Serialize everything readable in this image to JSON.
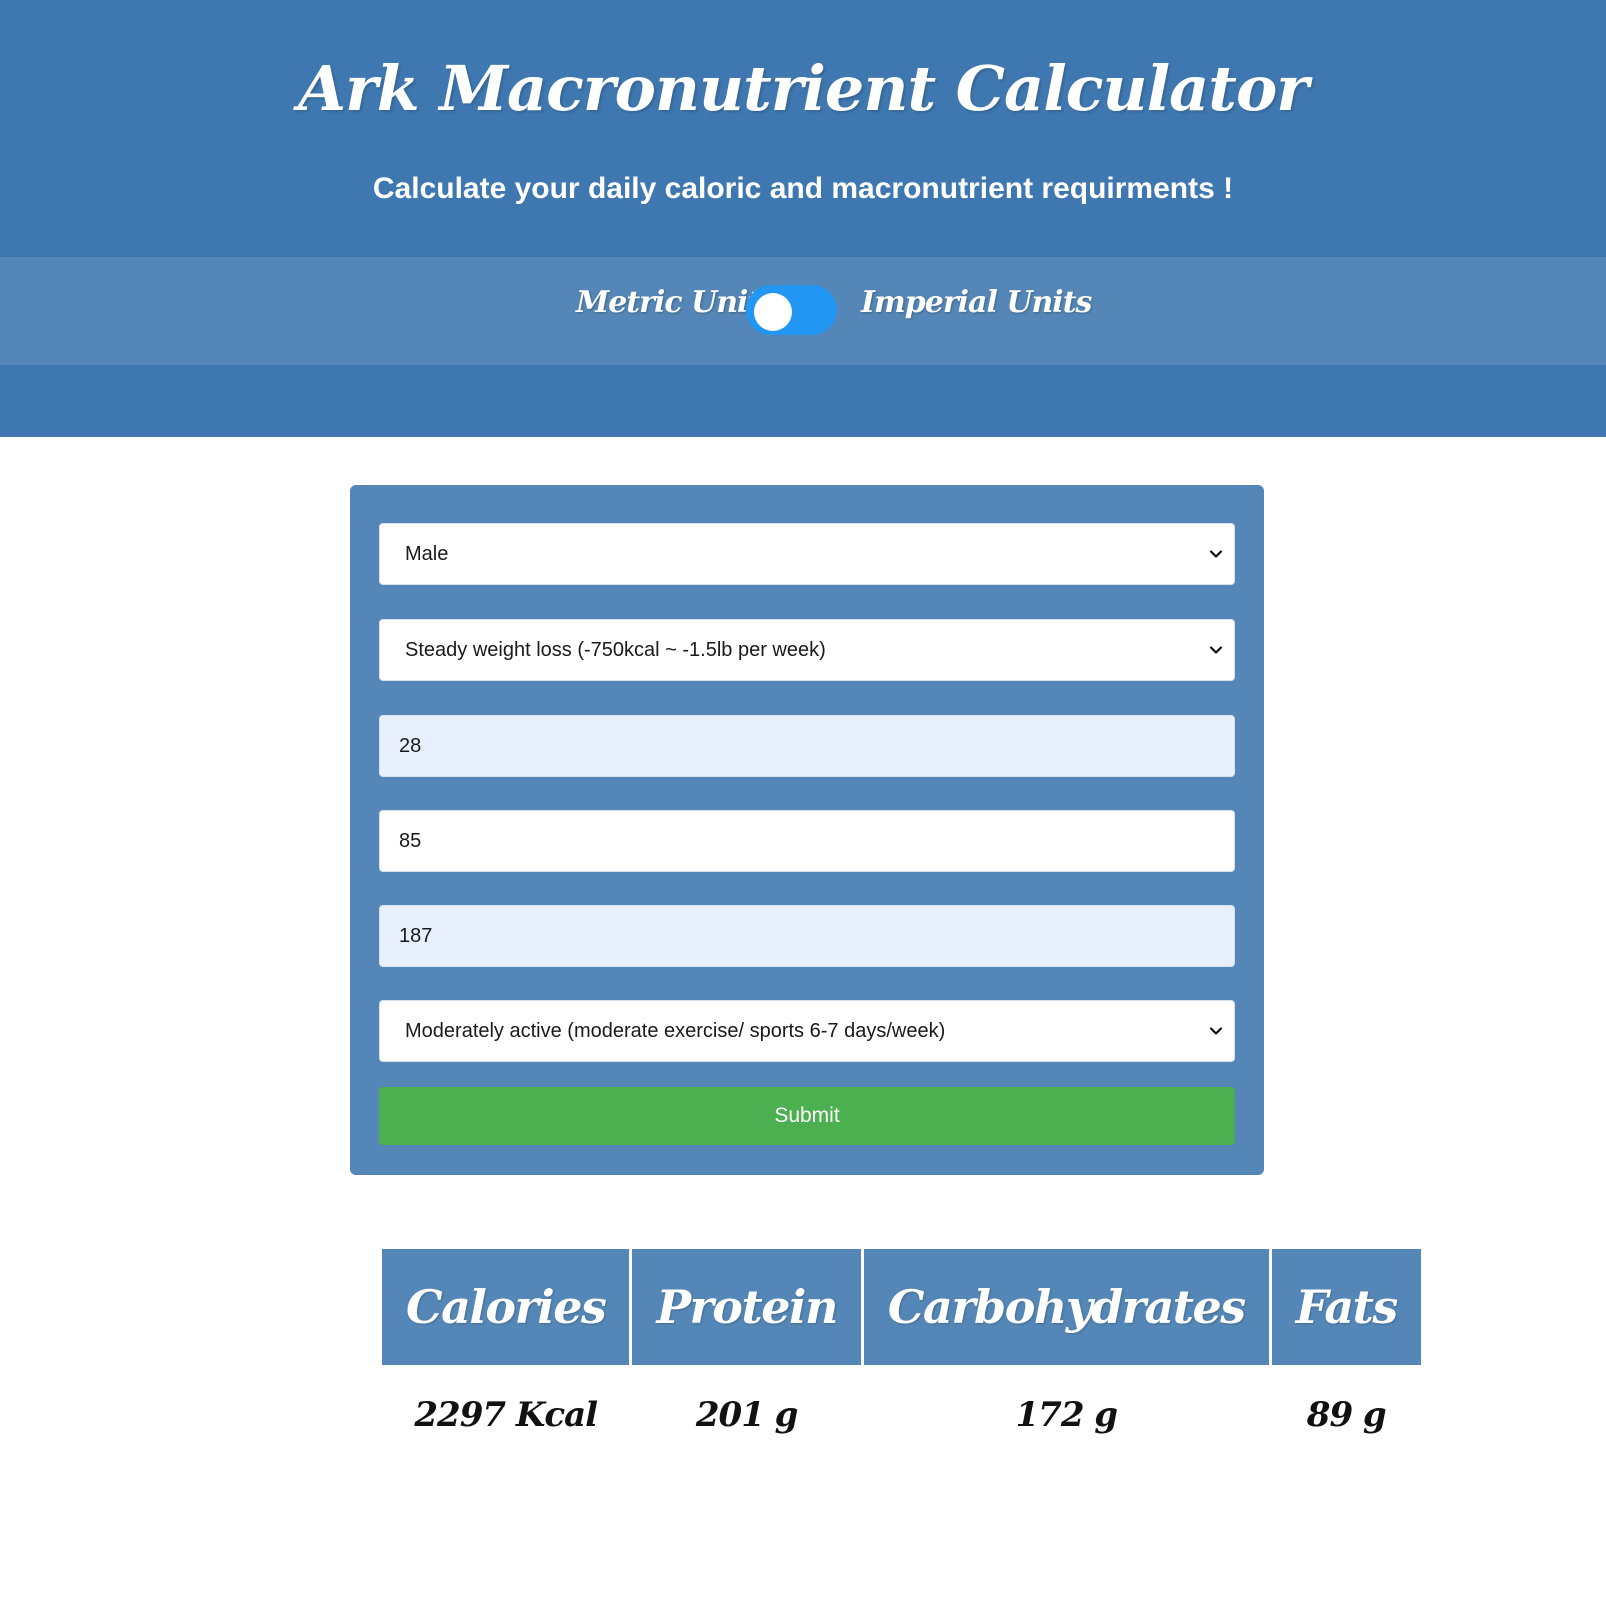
{
  "header": {
    "title": "Ark Macronutrient Calculator",
    "subtitle": "Calculate your daily caloric and macronutrient requirments !"
  },
  "units": {
    "metric_label": "Metric Units",
    "imperial_label": "Imperial Units",
    "toggle_on": true
  },
  "form": {
    "gender": "Male",
    "goal": "Steady weight loss (-750kcal ~ -1.5lb per week)",
    "age": "28",
    "weight": "85",
    "height": "187",
    "activity": "Moderately active (moderate exercise/ sports 6-7 days/week)",
    "submit_label": "Submit"
  },
  "results": {
    "headers": [
      "Calories",
      "Protein",
      "Carbohydrates",
      "Fats"
    ],
    "values": [
      "2297 Kcal",
      "201 g",
      "172 g",
      "89 g"
    ]
  },
  "colors": {
    "header_bg": "#3f78b0",
    "panel_bg": "#5487b7",
    "toggle": "#2196f3",
    "submit": "#4caf50"
  }
}
